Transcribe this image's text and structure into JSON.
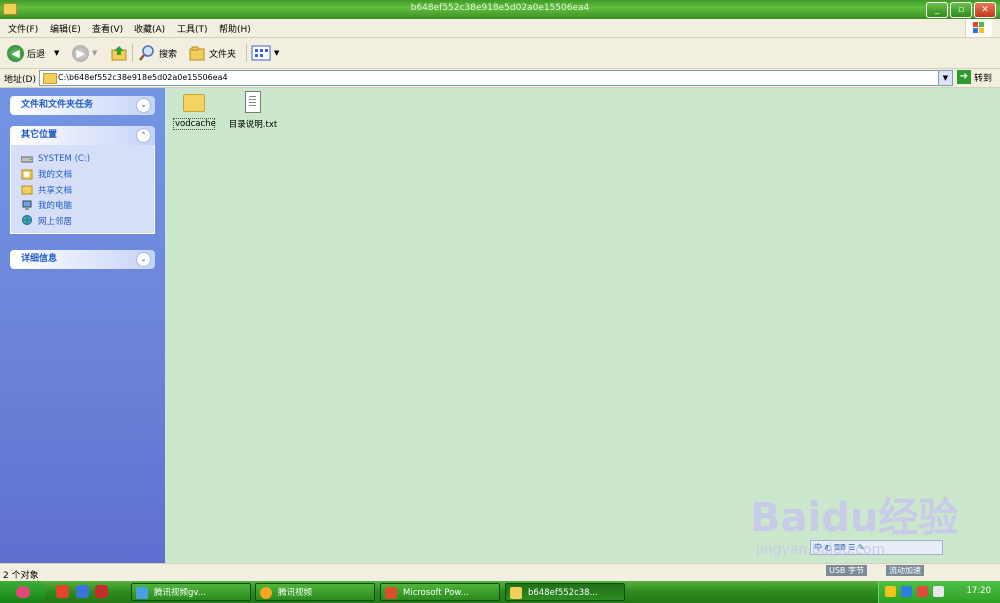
{
  "window": {
    "title": "b648ef552c38e918e5d02a0e15506ea4",
    "controls": [
      "minimize",
      "maximize",
      "close"
    ]
  },
  "menu": [
    "文件(F)",
    "编辑(E)",
    "查看(V)",
    "收藏(A)",
    "工具(T)",
    "帮助(H)"
  ],
  "toolbar": {
    "back": "后退",
    "search": "搜索",
    "folders": "文件夹"
  },
  "address": {
    "label": "地址(D)",
    "path": "C:\\b648ef552c38e918e5d02a0e15506ea4",
    "go": "转到"
  },
  "sidebar": {
    "file_tasks": "文件和文件夹任务",
    "other_places": {
      "title": "其它位置",
      "items": [
        {
          "label": "SYSTEM (C:)",
          "icon": "drive-icon"
        },
        {
          "label": "我的文档",
          "icon": "my-documents-icon"
        },
        {
          "label": "共享文档",
          "icon": "shared-folder-icon"
        },
        {
          "label": "我的电脑",
          "icon": "my-computer-icon"
        },
        {
          "label": "网上邻居",
          "icon": "network-places-icon"
        }
      ]
    },
    "details": "详细信息"
  },
  "files": [
    {
      "name": "vodcache",
      "type": "folder"
    },
    {
      "name": "目录说明.txt",
      "type": "text"
    }
  ],
  "status": {
    "object_count": "2 个对象"
  },
  "taskbar": {
    "tasks": [
      {
        "label": "腾讯视频gv..."
      },
      {
        "label": "腾讯视频"
      },
      {
        "label": "Microsoft Pow..."
      },
      {
        "label": "b648ef552c38..."
      }
    ],
    "clock": "17:20",
    "lang": "USB 字节",
    "ime": "流动加速"
  },
  "watermark": {
    "brand": "Baidu经验",
    "url": "jingyan.baidu.com"
  },
  "colors": {
    "content_bg": "#cbe8cc",
    "sidebar_bg": "#6a82d8",
    "title_green": "#4aa52f"
  }
}
